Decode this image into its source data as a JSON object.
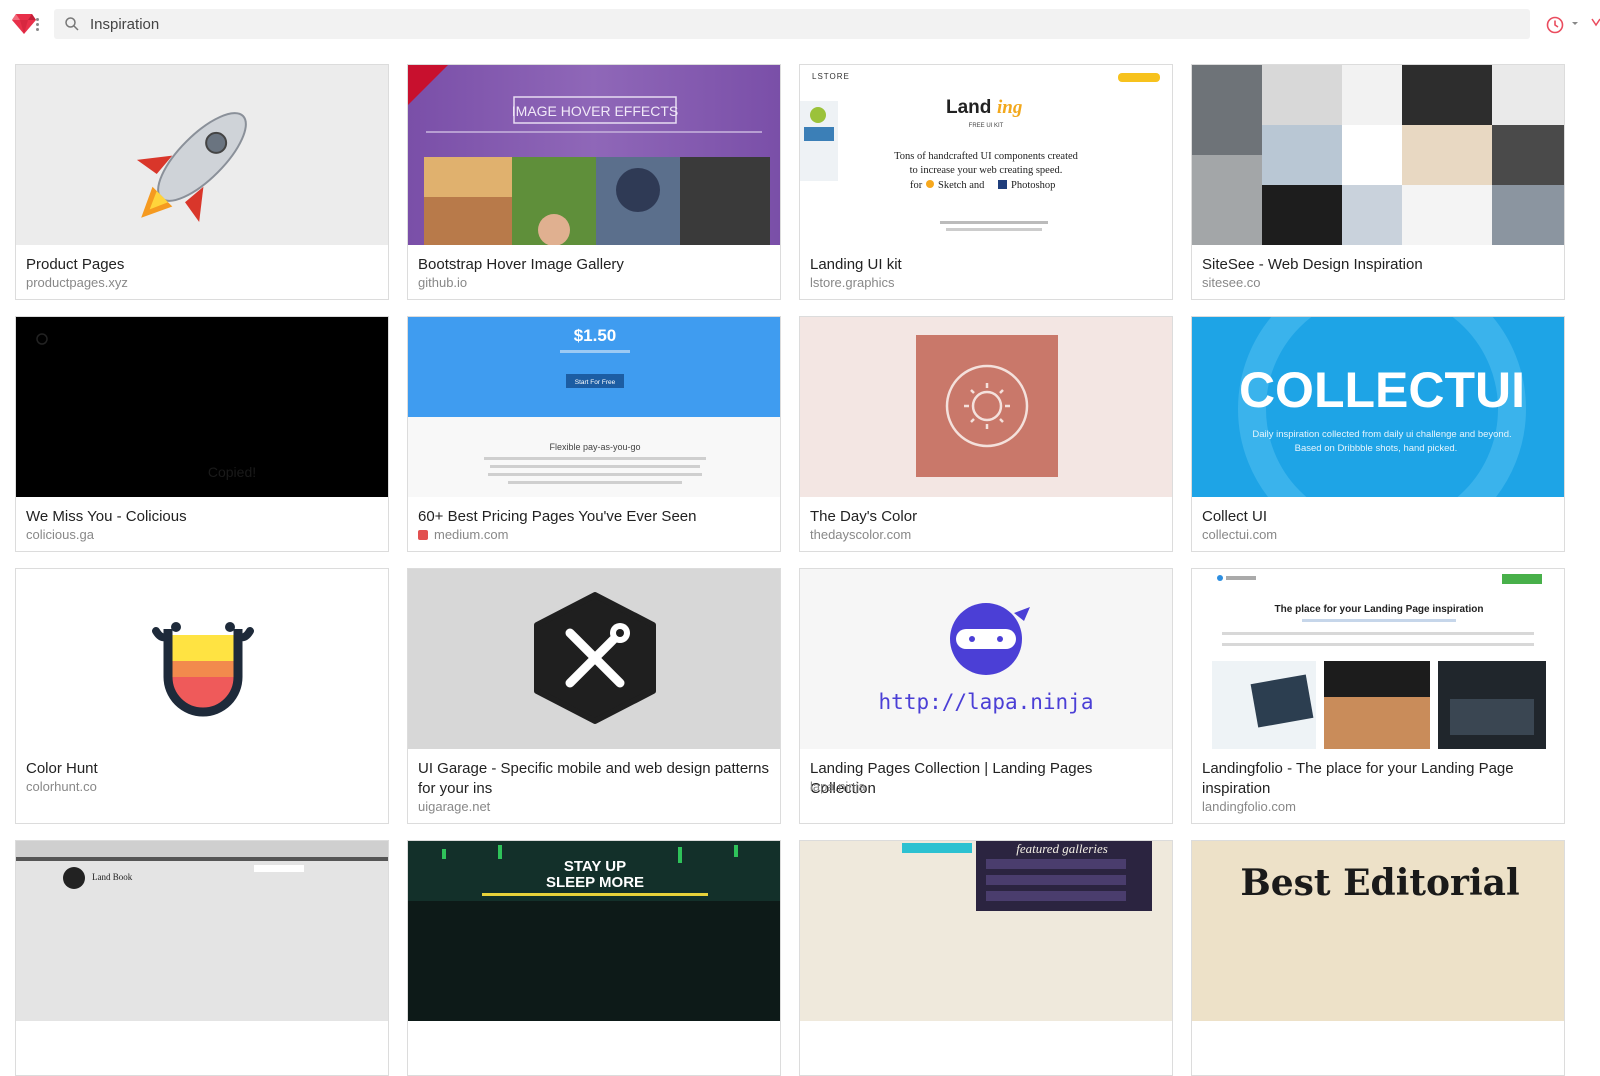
{
  "search": {
    "value": "Inspiration",
    "placeholder": ""
  },
  "colors": {
    "brand": "#e8304a",
    "accent": "#ea4c5e"
  },
  "icons": {
    "logo": "ruby-gem-icon",
    "search": "search-icon",
    "history": "clock-icon"
  },
  "cards": [
    {
      "title": "Product Pages",
      "domain": "productpages.xyz",
      "thumb": "rocket"
    },
    {
      "title": "Bootstrap Hover Image Gallery",
      "domain": "github.io",
      "thumb": "hover",
      "thumb_text": "IMAGE HOVER EFFECTS"
    },
    {
      "title": "Landing UI kit",
      "domain": "lstore.graphics",
      "thumb": "landing",
      "thumb_brand": "LSTORE",
      "thumb_logo_a": "Land",
      "thumb_logo_b": "ing",
      "thumb_sub": "FREE UI KIT",
      "thumb_line1": "Tons of  handcrafted UI components created",
      "thumb_line2": "to increase your web creating speed.",
      "thumb_line3a": "for",
      "thumb_line3b": "Sketch and",
      "thumb_line3c": "Photoshop"
    },
    {
      "title": "SiteSee - Web Design Inspiration",
      "domain": "sitesee.co",
      "thumb": "sitesee"
    },
    {
      "title": "We Miss You - Colicious",
      "domain": "colicious.ga",
      "thumb": "black",
      "thumb_text": "Copied!"
    },
    {
      "title": "60+ Best Pricing Pages You've Ever Seen",
      "domain": "medium.com",
      "thumb": "pricing",
      "favicon": true,
      "thumb_price": "$1.50",
      "thumb_btn": "Start For Free",
      "thumb_heading": "Flexible pay-as-you-go"
    },
    {
      "title": "The Day's Color",
      "domain": "thedayscolor.com",
      "thumb": "dayscolor"
    },
    {
      "title": "Collect UI",
      "domain": "collectui.com",
      "thumb": "collectui",
      "thumb_text": "COLLECTUI",
      "thumb_line1": "Daily inspiration collected from daily ui challenge and beyond.",
      "thumb_line2": "Based on Dribbble shots, hand picked."
    },
    {
      "title": "Color Hunt",
      "domain": "colorhunt.co",
      "thumb": "colorhunt"
    },
    {
      "title": "UI Garage - Specific mobile and web design patterns for your ins",
      "domain": "uigarage.net",
      "thumb": "uigarage"
    },
    {
      "title": "Landing Pages Collection | Landing Pages Collection",
      "domain": "lapa.ninja",
      "thumb": "lapa",
      "thumb_text": "http://lapa.ninja"
    },
    {
      "title": "Landingfolio - The place for your Landing Page inspiration",
      "domain": "landingfolio.com",
      "thumb": "landingfolio",
      "thumb_heading": "The place for your Landing Page inspiration"
    },
    {
      "title": "",
      "domain": "",
      "thumb": "landbook",
      "thumb_text": "Land Book"
    },
    {
      "title": "",
      "domain": "",
      "thumb": "stayup",
      "thumb_line1": "STAY UP",
      "thumb_line2": "SLEEP MORE"
    },
    {
      "title": "",
      "domain": "",
      "thumb": "featured",
      "thumb_text": "featured galleries"
    },
    {
      "title": "",
      "domain": "",
      "thumb": "editorial",
      "thumb_text": "Best Editorial"
    }
  ]
}
